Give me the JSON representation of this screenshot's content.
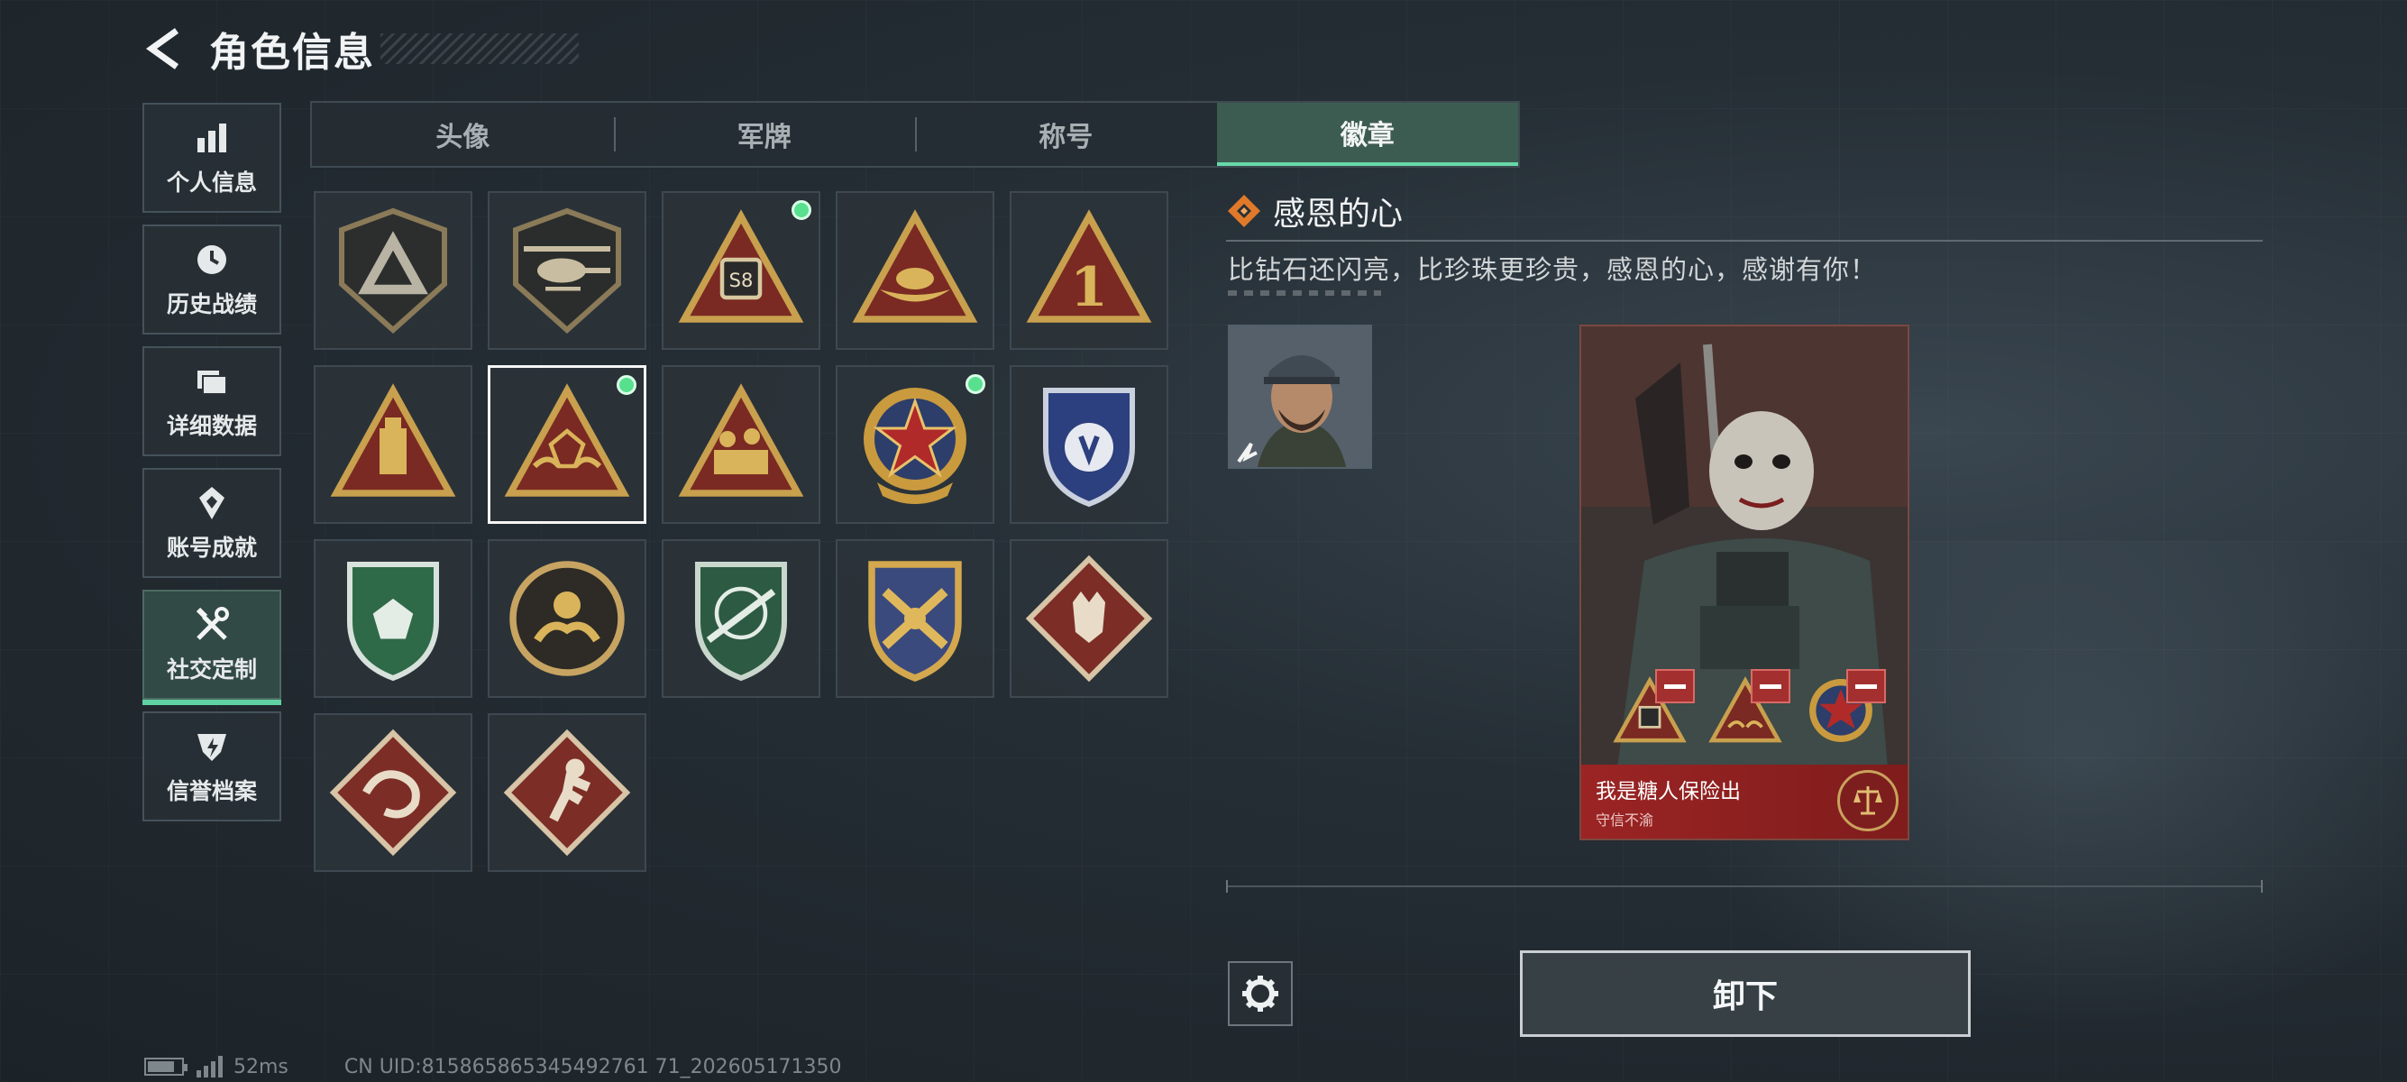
{
  "header": {
    "title": "角色信息",
    "back_icon": "chevron-left-icon"
  },
  "sidebar": {
    "items": [
      {
        "label": "个人信息",
        "icon": "bar-chart-icon",
        "active": false
      },
      {
        "label": "历史战绩",
        "icon": "history-clock-icon",
        "active": false
      },
      {
        "label": "详细数据",
        "icon": "folder-icon",
        "active": false
      },
      {
        "label": "账号成就",
        "icon": "achievement-icon",
        "active": false
      },
      {
        "label": "社交定制",
        "icon": "wrench-screwdriver-icon",
        "active": true
      },
      {
        "label": "信誉档案",
        "icon": "shield-credit-icon",
        "active": false
      }
    ]
  },
  "tabs": [
    {
      "label": "头像",
      "active": false
    },
    {
      "label": "军牌",
      "active": false
    },
    {
      "label": "称号",
      "active": false
    },
    {
      "label": "徽章",
      "active": true
    }
  ],
  "badges": [
    {
      "name": "delta-shield-badge",
      "new": false
    },
    {
      "name": "helicopter-badge",
      "new": false
    },
    {
      "name": "s8-badge",
      "new": true
    },
    {
      "name": "bird-nest-badge",
      "new": false
    },
    {
      "name": "number-one-badge",
      "new": false
    },
    {
      "name": "usb-badge",
      "new": false
    },
    {
      "name": "grateful-heart-badge",
      "new": true,
      "selected": true
    },
    {
      "name": "team-soldiers-badge",
      "new": false
    },
    {
      "name": "star-emblem-badge",
      "new": true
    },
    {
      "name": "blue-shield-badge",
      "new": false
    },
    {
      "name": "green-gem-badge",
      "new": false
    },
    {
      "name": "round-crest-badge",
      "new": false
    },
    {
      "name": "sniper-badge",
      "new": false
    },
    {
      "name": "crossed-arms-badge",
      "new": false
    },
    {
      "name": "wolf-badge",
      "new": false
    },
    {
      "name": "dragon-badge",
      "new": false
    },
    {
      "name": "runner-badge",
      "new": false
    }
  ],
  "detail": {
    "title": "感恩的心",
    "description": "比钻石还闪亮，比珍珠更珍贵，感恩的心，感谢有你！"
  },
  "card": {
    "name": "我是糖人保险出",
    "subtitle": "守信不渝",
    "slots": [
      "s8-badge",
      "grateful-heart-badge",
      "star-emblem-badge"
    ]
  },
  "actions": {
    "unequip_label": "卸下"
  },
  "status": {
    "ping": "52ms",
    "uid": "CN UID:815865865345492761 71_202605171350"
  },
  "colors": {
    "accent_green": "#66d9a8",
    "new_dot": "#58e08e",
    "card_red": "#9b2424"
  }
}
